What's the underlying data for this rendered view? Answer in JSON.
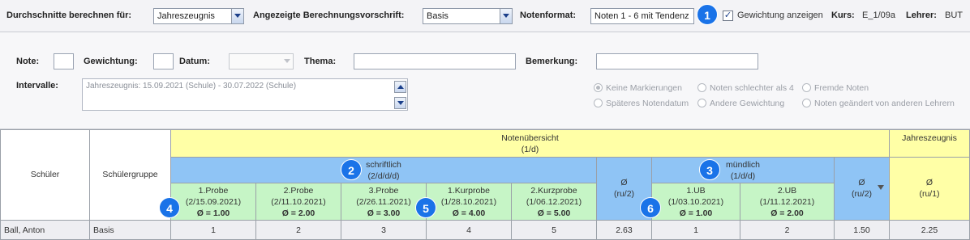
{
  "toolbar": {
    "durchschnitte_label": "Durchschnitte berechnen für:",
    "durchschnitte_value": "Jahreszeugnis",
    "vorschrift_label": "Angezeigte Berechnungsvorschrift:",
    "vorschrift_value": "Basis",
    "notenformat_label": "Notenformat:",
    "notenformat_value": "Noten 1 - 6 mit Tendenz",
    "gewichtung_label": "Gewichtung anzeigen",
    "gewichtung_checked": "✓",
    "kurs_label": "Kurs:",
    "kurs_value": "E_1/09a",
    "lehrer_label": "Lehrer:",
    "lehrer_value": "BUT"
  },
  "badges": [
    "1",
    "2",
    "3",
    "4",
    "5",
    "6"
  ],
  "filter": {
    "note_label": "Note:",
    "gewichtung_label": "Gewichtung:",
    "datum_label": "Datum:",
    "thema_label": "Thema:",
    "bemerkung_label": "Bemerkung:",
    "intervalle_label": "Intervalle:",
    "intervalle_value": "Jahreszeugnis: 15.09.2021 (Schule) - 30.07.2022 (Schule)",
    "radios": [
      {
        "label": "Keine Markierungen",
        "selected": true
      },
      {
        "label": "Noten schlechter als 4",
        "selected": false
      },
      {
        "label": "Fremde Noten",
        "selected": false
      },
      {
        "label": "Späteres Notendatum",
        "selected": false
      },
      {
        "label": "Andere Gewichtung",
        "selected": false
      },
      {
        "label": "Noten geändert von anderen Lehrern",
        "selected": false
      }
    ]
  },
  "table": {
    "schueler_header": "Schüler",
    "gruppe_header": "Schülergruppe",
    "uebersicht_title": "Notenübersicht",
    "uebersicht_sub": "(1/d)",
    "zeugnis_title": "Jahreszeugnis",
    "schriftlich_title": "schriftlich",
    "schriftlich_sub": "(2/d/d/d)",
    "muendlich_title": "mündlich",
    "muendlich_sub": "(1/d/d)",
    "avg_symbol": "Ø",
    "schriftlich_avg_sub": "(ru/2)",
    "muendlich_avg_sub": "(ru/2)",
    "zeugnis_avg_sub": "(ru/1)",
    "exams": [
      {
        "name": "1.Probe",
        "meta": "(2/15.09.2021)",
        "avg": "Ø = 1.00"
      },
      {
        "name": "2.Probe",
        "meta": "(2/11.10.2021)",
        "avg": "Ø = 2.00"
      },
      {
        "name": "3.Probe",
        "meta": "(2/26.11.2021)",
        "avg": "Ø = 3.00"
      },
      {
        "name": "1.Kurprobe",
        "meta": "(1/28.10.2021)",
        "avg": "Ø = 4.00"
      },
      {
        "name": "2.Kurzprobe",
        "meta": "(1/06.12.2021)",
        "avg": "Ø = 5.00"
      }
    ],
    "oral": [
      {
        "name": "1.UB",
        "meta": "(1/03.10.2021)",
        "avg": "Ø = 1.00"
      },
      {
        "name": "2.UB",
        "meta": "(1/11.12.2021)",
        "avg": "Ø = 2.00"
      }
    ],
    "rows": [
      {
        "student": "Ball, Anton",
        "group": "Basis",
        "written": [
          "1",
          "2",
          "3",
          "4",
          "5"
        ],
        "written_avg": "2.63",
        "oral": [
          "1",
          "2"
        ],
        "oral_avg": "1.50",
        "final_avg": "2.25"
      }
    ]
  }
}
